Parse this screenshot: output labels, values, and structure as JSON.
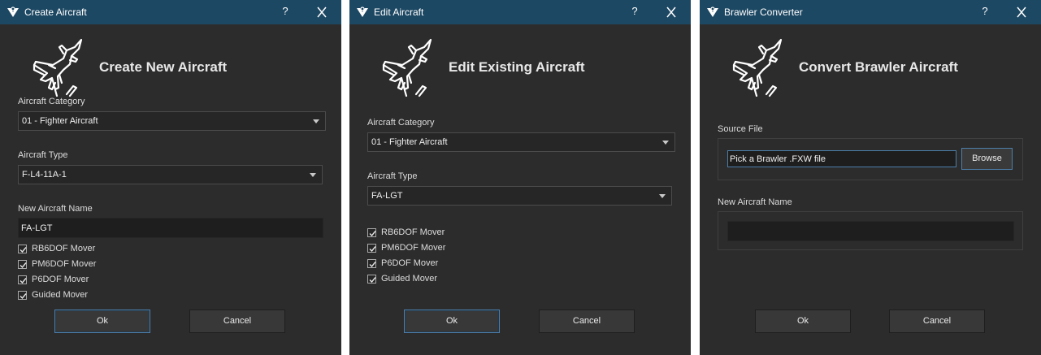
{
  "dialogs": [
    {
      "title": "Create Aircraft",
      "help": "?",
      "heading": "Create New Aircraft",
      "category_label": "Aircraft Category",
      "category_value": "01 - Fighter Aircraft",
      "type_label": "Aircraft Type",
      "type_value": "F-L4-11A-1",
      "name_label": "New Aircraft Name",
      "name_value": "FA-LGT",
      "movers": [
        {
          "label": "RB6DOF Mover",
          "checked": true
        },
        {
          "label": "PM6DOF Mover",
          "checked": true
        },
        {
          "label": "P6DOF Mover",
          "checked": true
        },
        {
          "label": "Guided Mover",
          "checked": true
        }
      ],
      "ok": "Ok",
      "cancel": "Cancel"
    },
    {
      "title": "Edit Aircraft",
      "help": "?",
      "heading": "Edit Existing Aircraft",
      "category_label": "Aircraft Category",
      "category_value": "01 - Fighter Aircraft",
      "type_label": "Aircraft Type",
      "type_value": "FA-LGT",
      "movers": [
        {
          "label": "RB6DOF Mover",
          "checked": true
        },
        {
          "label": "PM6DOF Mover",
          "checked": true
        },
        {
          "label": "P6DOF Mover",
          "checked": true
        },
        {
          "label": "Guided Mover",
          "checked": true
        }
      ],
      "ok": "Ok",
      "cancel": "Cancel"
    },
    {
      "title": "Brawler Converter",
      "help": "?",
      "heading": "Convert Brawler Aircraft",
      "source_label": "Source File",
      "source_placeholder": "Pick a Brawler .FXW file",
      "browse": "Browse",
      "name_label": "New Aircraft Name",
      "name_value": "",
      "ok": "Ok",
      "cancel": "Cancel"
    }
  ],
  "colors": {
    "titlebar": "#1d4863",
    "dialog_bg": "#2c2c2c",
    "accent": "#4d7eaa"
  },
  "icons": {
    "app_logo": "app-logo-icon",
    "close": "close-icon",
    "aircraft": "fighter-jet-icon",
    "dropdown": "chevron-down-icon",
    "checkbox": "checkmark-icon"
  }
}
